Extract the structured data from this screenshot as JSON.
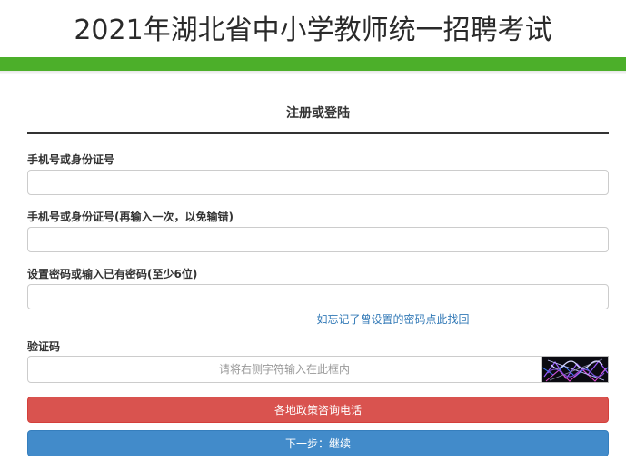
{
  "header": {
    "title": "2021年湖北省中小学教师统一招聘考试"
  },
  "panel": {
    "title": "注册或登陆"
  },
  "form": {
    "id_label": "手机号或身份证号",
    "id_value": "",
    "id_confirm_label": "手机号或身份证号(再输入一次，以免输错)",
    "id_confirm_value": "",
    "password_label": "设置密码或输入已有密码(至少6位)",
    "password_value": "",
    "forgot_link": "如忘记了曾设置的密码点此找回",
    "captcha_label": "验证码",
    "captcha_placeholder": "请将右侧字符输入在此框内",
    "captcha_value": ""
  },
  "buttons": {
    "hotline": "各地政策咨询电话",
    "next": "下一步：继续"
  },
  "colors": {
    "green_bar": "#4caf2a",
    "hotline_button": "#d9534f",
    "next_button": "#428bca",
    "link": "#337ab7"
  }
}
